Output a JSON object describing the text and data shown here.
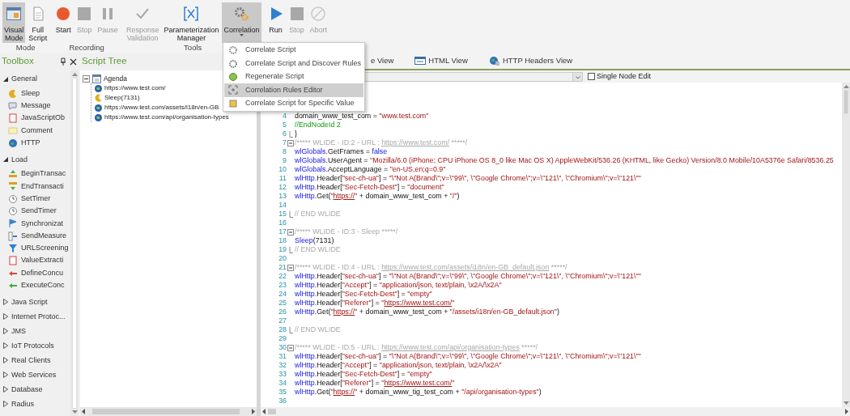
{
  "toolbar": {
    "groups": [
      {
        "label": "Mode",
        "buttons": [
          {
            "label": "Visual Mode",
            "selected": true,
            "disabled": false,
            "dropdown": false
          },
          {
            "label": "Full Script",
            "selected": false,
            "disabled": false,
            "dropdown": false
          }
        ]
      },
      {
        "label": "Recording",
        "buttons": [
          {
            "label": "Start",
            "selected": false,
            "disabled": false,
            "dropdown": false
          },
          {
            "label": "Stop",
            "selected": false,
            "disabled": true,
            "dropdown": false
          },
          {
            "label": "Pause",
            "selected": false,
            "disabled": true,
            "dropdown": false
          }
        ]
      },
      {
        "label": "Tools",
        "buttons": [
          {
            "label": "Response Validation",
            "selected": false,
            "disabled": true,
            "dropdown": false
          },
          {
            "label": "Parameterization Manager",
            "selected": false,
            "disabled": false,
            "dropdown": false
          },
          {
            "label": "Correlation",
            "selected": true,
            "disabled": false,
            "dropdown": true
          }
        ]
      },
      {
        "buttons": [
          {
            "label": "Run",
            "selected": false,
            "disabled": false,
            "dropdown": false
          },
          {
            "label": "Stop",
            "selected": false,
            "disabled": true,
            "dropdown": false
          },
          {
            "label": "Abort",
            "selected": false,
            "disabled": true,
            "dropdown": false
          }
        ]
      }
    ]
  },
  "correlation_menu": {
    "items": [
      {
        "label": "Correlate Script",
        "selected": false
      },
      {
        "label": "Correlate Script and Discover Rules",
        "selected": false
      },
      {
        "label": "Regenerate Script",
        "selected": false
      },
      {
        "label": "Correlation Rules Editor",
        "selected": true
      },
      {
        "label": "Correlate Script for Specific Value",
        "selected": false
      }
    ]
  },
  "toolbox": {
    "title": "Toolbox",
    "sections": [
      {
        "label": "General",
        "expanded": true,
        "items": [
          {
            "label": "Sleep"
          },
          {
            "label": "Message"
          },
          {
            "label": "JavaScriptOb"
          },
          {
            "label": "Comment"
          },
          {
            "label": "HTTP"
          }
        ]
      },
      {
        "label": "Load",
        "expanded": true,
        "items": [
          {
            "label": "BeginTransac"
          },
          {
            "label": "EndTransacti"
          },
          {
            "label": "SetTimer"
          },
          {
            "label": "SendTimer"
          },
          {
            "label": "Synchronizat"
          },
          {
            "label": "SendMeasure"
          },
          {
            "label": "URLScreening"
          },
          {
            "label": "ValueExtracti"
          },
          {
            "label": "DefineConcu"
          },
          {
            "label": "ExecuteConc"
          }
        ]
      },
      {
        "label": "Java Script",
        "expanded": false
      },
      {
        "label": "Internet Protoc...",
        "expanded": false
      },
      {
        "label": "JMS",
        "expanded": false
      },
      {
        "label": "IoT Protocols",
        "expanded": false
      },
      {
        "label": "Real Clients",
        "expanded": false
      },
      {
        "label": "Web Services",
        "expanded": false
      },
      {
        "label": "Database",
        "expanded": false
      },
      {
        "label": "Radius",
        "expanded": false
      }
    ]
  },
  "script_tree": {
    "title": "Script Tree",
    "root": {
      "label": "Agenda",
      "expanded": true,
      "children": [
        {
          "kind": "request",
          "label": "https://www.test.com/"
        },
        {
          "kind": "sleep",
          "label": "Sleep(7131)"
        },
        {
          "kind": "request",
          "label": "https://www.test.com/assets/i18n/en-GB"
        },
        {
          "kind": "request",
          "label": "https://www.test.com/api/organisation-types"
        }
      ]
    }
  },
  "editor": {
    "tabs": [
      {
        "label": "e View"
      },
      {
        "label": "HTML View"
      },
      {
        "label": "HTTP Headers View"
      }
    ],
    "single_node_edit": {
      "label": "Single Node Edit",
      "checked": false
    },
    "lines": [
      {
        "number": "4",
        "kind": "code",
        "segments": [
          {
            "kind": "plain",
            "text": "domain_www_test_com = "
          },
          {
            "kind": "string",
            "text": "\"www.test.com\""
          }
        ]
      },
      {
        "number": "5",
        "kind": "code",
        "segments": [
          {
            "kind": "comment",
            "text": "//EndNodeId 2"
          }
        ]
      },
      {
        "number": "6",
        "kind": "block_end",
        "segments": [
          {
            "kind": "plain",
            "text": "}"
          }
        ]
      },
      {
        "number": "7",
        "kind": "block_start",
        "segments": [
          {
            "kind": "header",
            "text": "/***** WLIDE - ID:2 - URL : "
          },
          {
            "kind": "header_link",
            "text": "https://www.test.com/"
          },
          {
            "kind": "header",
            "text": " *****/"
          }
        ]
      },
      {
        "number": "8",
        "kind": "code",
        "segments": [
          {
            "kind": "keyword",
            "text": "wlGlobals"
          },
          {
            "kind": "plain",
            "text": ".GetFrames = "
          },
          {
            "kind": "keyword",
            "text": "false"
          }
        ]
      },
      {
        "number": "9",
        "kind": "code",
        "segments": [
          {
            "kind": "keyword",
            "text": "wlGlobals"
          },
          {
            "kind": "plain",
            "text": ".UserAgent = "
          },
          {
            "kind": "string",
            "text": "\"Mozilla/6.0 (iPhone; CPU iPhone OS 8_0 like Mac OS X) AppleWebKit/536.26 (KHTML, like Gecko) Version/8.0 Mobile/10A5376e Safari/8536.25"
          }
        ]
      },
      {
        "number": "10",
        "kind": "code",
        "segments": [
          {
            "kind": "keyword",
            "text": "wlGlobals"
          },
          {
            "kind": "plain",
            "text": ".AcceptLanguage = "
          },
          {
            "kind": "string",
            "text": "\"en-US,en;q=0.9\""
          }
        ]
      },
      {
        "number": "11",
        "kind": "code",
        "segments": [
          {
            "kind": "keyword",
            "text": "wlHttp"
          },
          {
            "kind": "plain",
            "text": ".Header["
          },
          {
            "kind": "string",
            "text": "\"sec-ch-ua\""
          },
          {
            "kind": "plain",
            "text": "] = "
          },
          {
            "kind": "string",
            "text": "\"\\\"Not A(Brand\\\";v=\\\"99\\\", \\\"Google Chrome\\\";v=\\\"121\\\", \\\"Chromium\\\";v=\\\"121\\\"\""
          }
        ]
      },
      {
        "number": "12",
        "kind": "code",
        "segments": [
          {
            "kind": "keyword",
            "text": "wlHttp"
          },
          {
            "kind": "plain",
            "text": ".Header["
          },
          {
            "kind": "string",
            "text": "\"Sec-Fetch-Dest\""
          },
          {
            "kind": "plain",
            "text": "] = "
          },
          {
            "kind": "string",
            "text": "\"document\""
          }
        ]
      },
      {
        "number": "13",
        "kind": "code",
        "segments": [
          {
            "kind": "keyword",
            "text": "wlHttp"
          },
          {
            "kind": "plain",
            "text": ".Get("
          },
          {
            "kind": "string",
            "text": "\""
          },
          {
            "kind": "link",
            "text": "https://"
          },
          {
            "kind": "string",
            "text": "\""
          },
          {
            "kind": "plain",
            "text": " + domain_www_test_com + "
          },
          {
            "kind": "string",
            "text": "\"/\""
          },
          {
            "kind": "plain",
            "text": ")"
          }
        ]
      },
      {
        "number": "14",
        "kind": "code"
      },
      {
        "number": "15",
        "kind": "block_end",
        "segments": [
          {
            "kind": "header",
            "text": "// END WLIDE"
          }
        ]
      },
      {
        "number": "16",
        "kind": "code"
      },
      {
        "number": "17",
        "kind": "block_start",
        "segments": [
          {
            "kind": "header",
            "text": "/***** WLIDE - ID:3 - Sleep *****/"
          }
        ]
      },
      {
        "number": "18",
        "kind": "code",
        "segments": [
          {
            "kind": "keyword",
            "text": "Sleep"
          },
          {
            "kind": "plain",
            "text": "(7131)"
          }
        ]
      },
      {
        "number": "19",
        "kind": "block_end",
        "segments": [
          {
            "kind": "header",
            "text": "// END WLIDE"
          }
        ]
      },
      {
        "number": "20",
        "kind": "code"
      },
      {
        "number": "21",
        "kind": "block_start",
        "segments": [
          {
            "kind": "header",
            "text": "/***** WLIDE - ID:4 - URL : "
          },
          {
            "kind": "header_link",
            "text": "https://www.test.com/assets/i18n/en-GB_default.json"
          },
          {
            "kind": "header",
            "text": " *****/"
          }
        ]
      },
      {
        "number": "22",
        "kind": "code",
        "segments": [
          {
            "kind": "keyword",
            "text": "wlHttp"
          },
          {
            "kind": "plain",
            "text": ".Header["
          },
          {
            "kind": "string",
            "text": "\"sec-ch-ua\""
          },
          {
            "kind": "plain",
            "text": "] = "
          },
          {
            "kind": "string",
            "text": "\"\\\"Not A(Brand\\\";v=\\\"99\\\", \\\"Google Chrome\\\";v=\\\"121\\\", \\\"Chromium\\\";v=\\\"121\\\"\""
          }
        ]
      },
      {
        "number": "23",
        "kind": "code",
        "segments": [
          {
            "kind": "keyword",
            "text": "wlHttp"
          },
          {
            "kind": "plain",
            "text": ".Header["
          },
          {
            "kind": "string",
            "text": "\"Accept\""
          },
          {
            "kind": "plain",
            "text": "] = "
          },
          {
            "kind": "string",
            "text": "\"application/json, text/plain, \\x2A/\\x2A\""
          }
        ]
      },
      {
        "number": "24",
        "kind": "code",
        "segments": [
          {
            "kind": "keyword",
            "text": "wlHttp"
          },
          {
            "kind": "plain",
            "text": ".Header["
          },
          {
            "kind": "string",
            "text": "\"Sec-Fetch-Dest\""
          },
          {
            "kind": "plain",
            "text": "] = "
          },
          {
            "kind": "string",
            "text": "\"empty\""
          }
        ]
      },
      {
        "number": "25",
        "kind": "code",
        "segments": [
          {
            "kind": "keyword",
            "text": "wlHttp"
          },
          {
            "kind": "plain",
            "text": ".Header["
          },
          {
            "kind": "string",
            "text": "\"Referer\""
          },
          {
            "kind": "plain",
            "text": "] = "
          },
          {
            "kind": "string",
            "text": "\""
          },
          {
            "kind": "link",
            "text": "https://www.test.com/"
          },
          {
            "kind": "string",
            "text": "\""
          }
        ]
      },
      {
        "number": "26",
        "kind": "code",
        "segments": [
          {
            "kind": "keyword",
            "text": "wlHttp"
          },
          {
            "kind": "plain",
            "text": ".Get("
          },
          {
            "kind": "string",
            "text": "\""
          },
          {
            "kind": "link",
            "text": "https://"
          },
          {
            "kind": "string",
            "text": "\""
          },
          {
            "kind": "plain",
            "text": " + domain_www_test_com + "
          },
          {
            "kind": "string",
            "text": "\"/assets/i18n/en-GB_default.json\""
          },
          {
            "kind": "plain",
            "text": ")"
          }
        ]
      },
      {
        "number": "27",
        "kind": "code"
      },
      {
        "number": "28",
        "kind": "block_end",
        "segments": [
          {
            "kind": "header",
            "text": "// END WLIDE"
          }
        ]
      },
      {
        "number": "29",
        "kind": "code"
      },
      {
        "number": "30",
        "kind": "block_start",
        "segments": [
          {
            "kind": "header",
            "text": "/***** WLIDE - ID:5 - URL : "
          },
          {
            "kind": "header_link",
            "text": "https://www.test.com/api/organisation-types"
          },
          {
            "kind": "header",
            "text": " *****/"
          }
        ]
      },
      {
        "number": "31",
        "kind": "code",
        "segments": [
          {
            "kind": "keyword",
            "text": "wlHttp"
          },
          {
            "kind": "plain",
            "text": ".Header["
          },
          {
            "kind": "string",
            "text": "\"sec-ch-ua\""
          },
          {
            "kind": "plain",
            "text": "] = "
          },
          {
            "kind": "string",
            "text": "\"\\\"Not A(Brand\\\";v=\\\"99\\\", \\\"Google Chrome\\\";v=\\\"121\\\", \\\"Chromium\\\";v=\\\"121\\\"\""
          }
        ]
      },
      {
        "number": "32",
        "kind": "code",
        "segments": [
          {
            "kind": "keyword",
            "text": "wlHttp"
          },
          {
            "kind": "plain",
            "text": ".Header["
          },
          {
            "kind": "string",
            "text": "\"Accept\""
          },
          {
            "kind": "plain",
            "text": "] = "
          },
          {
            "kind": "string",
            "text": "\"application/json, text/plain, \\x2A/\\x2A\""
          }
        ]
      },
      {
        "number": "33",
        "kind": "code",
        "segments": [
          {
            "kind": "keyword",
            "text": "wlHttp"
          },
          {
            "kind": "plain",
            "text": ".Header["
          },
          {
            "kind": "string",
            "text": "\"Sec-Fetch-Dest\""
          },
          {
            "kind": "plain",
            "text": "] = "
          },
          {
            "kind": "string",
            "text": "\"empty\""
          }
        ]
      },
      {
        "number": "34",
        "kind": "code",
        "segments": [
          {
            "kind": "keyword",
            "text": "wlHttp"
          },
          {
            "kind": "plain",
            "text": ".Header["
          },
          {
            "kind": "string",
            "text": "\"Referer\""
          },
          {
            "kind": "plain",
            "text": "] = "
          },
          {
            "kind": "string",
            "text": "\""
          },
          {
            "kind": "link",
            "text": "https://www.test.com/"
          },
          {
            "kind": "string",
            "text": "\""
          }
        ]
      },
      {
        "number": "35",
        "kind": "code",
        "segments": [
          {
            "kind": "keyword",
            "text": "wlHttp"
          },
          {
            "kind": "plain",
            "text": ".Get("
          },
          {
            "kind": "string",
            "text": "\""
          },
          {
            "kind": "link",
            "text": "https://"
          },
          {
            "kind": "string",
            "text": "\""
          },
          {
            "kind": "plain",
            "text": " + domain_www_tig_test_com + "
          },
          {
            "kind": "string",
            "text": "\"/api/organisation-types\""
          },
          {
            "kind": "plain",
            "text": ")"
          }
        ]
      },
      {
        "number": "36",
        "kind": "code"
      }
    ]
  }
}
